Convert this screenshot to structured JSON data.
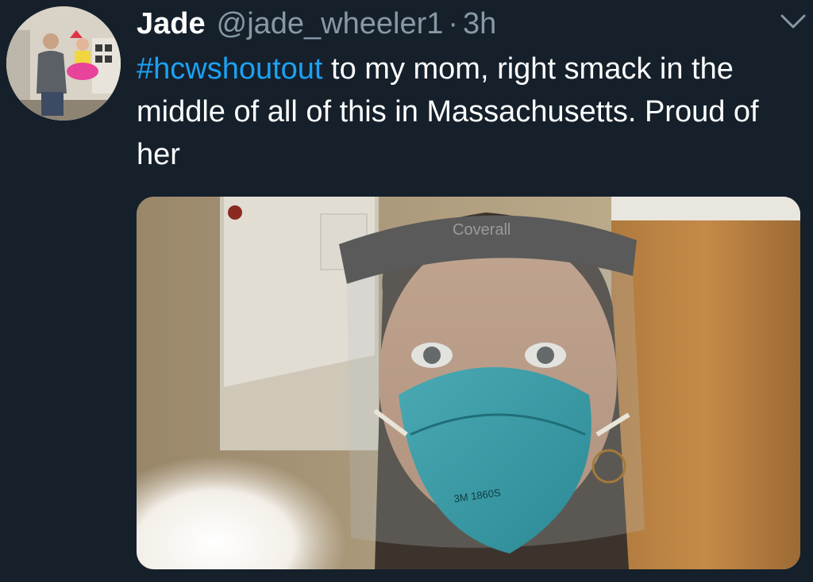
{
  "tweet": {
    "author_name": "Jade",
    "handle": "@jade_wheeler1",
    "separator": "·",
    "time": "3h",
    "hashtag": "#hcwshoutout",
    "text": " to my mom, right smack in the middle of all of this in Massachusetts. Proud of her",
    "menu_icon": "chevron-down-icon"
  },
  "media": {
    "shield_brand": "Coverall",
    "mask_model": "3M 1860S"
  },
  "colors": {
    "background": "#15202b",
    "secondary_text": "#8899a6",
    "link": "#1da1f2"
  }
}
